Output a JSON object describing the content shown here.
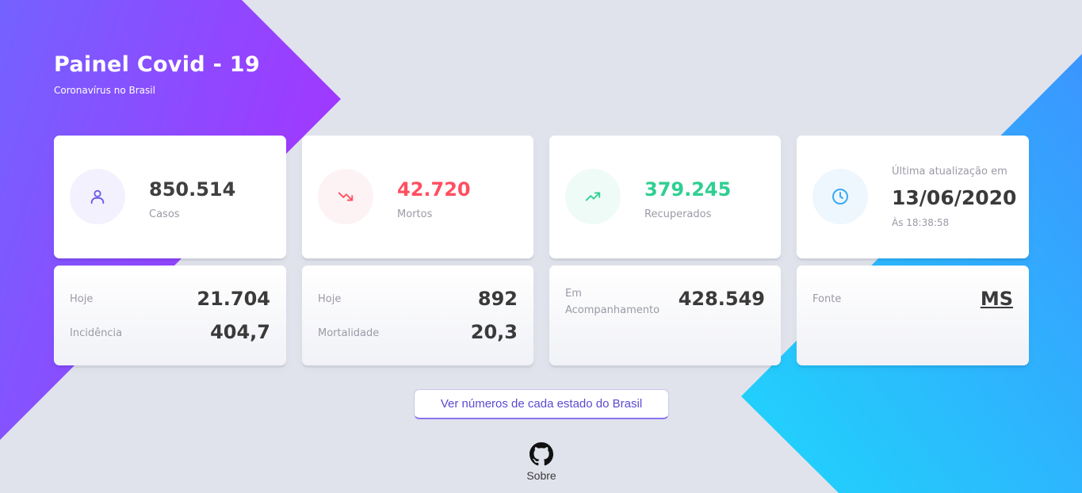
{
  "header": {
    "title": "Painel Covid - 19",
    "subtitle": "Coronavírus no Brasil"
  },
  "colors": {
    "cases": "#3f3f3f",
    "deaths": "#ff4f60",
    "recovered": "#2fcf92",
    "accent": "#7a4cff",
    "sky": "#27b9f6"
  },
  "cards": {
    "cases": {
      "icon": "user-icon",
      "value": "850.514",
      "label": "Casos"
    },
    "deaths": {
      "icon": "trending-down-icon",
      "value": "42.720",
      "label": "Mortos"
    },
    "recovered": {
      "icon": "trending-up-icon",
      "value": "379.245",
      "label": "Recuperados"
    },
    "update": {
      "icon": "clock-icon",
      "label": "Última atualização em",
      "date": "13/06/2020",
      "time": "Às 18:38:58"
    }
  },
  "details": {
    "cases": {
      "today_label": "Hoje",
      "today_value": "21.704",
      "incidence_label": "Incidência",
      "incidence_value": "404,7"
    },
    "deaths": {
      "today_label": "Hoje",
      "today_value": "892",
      "mortality_label": "Mortalidade",
      "mortality_value": "20,3"
    },
    "tracking": {
      "label_1": "Em",
      "label_2": "Acompanhamento",
      "value": "428.549"
    },
    "source": {
      "label": "Fonte",
      "link": "MS"
    }
  },
  "cta": {
    "label": "Ver números de cada estado do Brasil"
  },
  "footer": {
    "icon": "github-icon",
    "label": "Sobre"
  }
}
